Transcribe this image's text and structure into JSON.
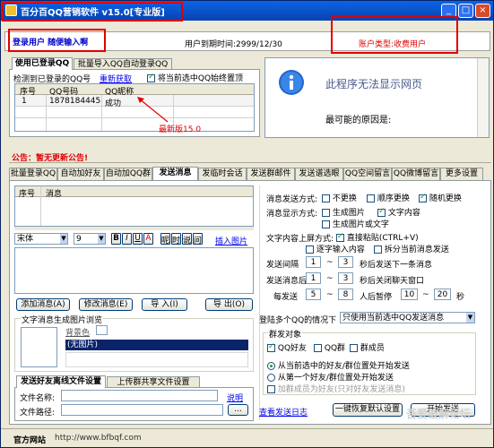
{
  "window": {
    "title": "百分百QQ营销软件 v15.0[专业版]",
    "min": "_",
    "max": "□",
    "close": "×"
  },
  "info": {
    "user_hint": "登录用户 随便输入啊",
    "expire_label": "用户到期时间:2999/12/30",
    "account_type": "账户类型:收费用户"
  },
  "qq_tabs": [
    "使用已登录QQ",
    "批量导入QQ自动登录QQ"
  ],
  "qq_section": {
    "detect_label": "检测到已登录的QQ号",
    "refresh_link": "重新获取",
    "pin_label": "将当前选中QQ始终置顶",
    "columns": [
      "序号",
      "QQ号码",
      "QQ昵称"
    ],
    "rows": [
      {
        "idx": "1",
        "qq": "1878184445",
        "nick": "成功"
      }
    ],
    "version_note": "最新版15.0"
  },
  "web_panel": {
    "message": "此程序无法显示网页",
    "reason": "最可能的原因是:"
  },
  "notice": "公告：暂无更新公告!",
  "main_tabs": [
    "批量登录QQ",
    "自动加好友",
    "自动加QQ群",
    "发送消息",
    "发临时会话",
    "发送群邮件",
    "发送谱选眼",
    "QQ空间留言",
    "QQ微博留言",
    "更多设置"
  ],
  "messages": {
    "columns": [
      "序号",
      "消息"
    ],
    "font_name": "宋体",
    "font_size": "9",
    "style_buttons": [
      "B",
      "I",
      "U",
      "A"
    ],
    "effect_buttons": [
      "呢",
      "时",
      "说",
      "问"
    ],
    "insert_image": "插入图片",
    "buttons": [
      "添加消息(A)",
      "修改消息(E)",
      "导  入(I)",
      "导  出(O)"
    ]
  },
  "preview": {
    "title": "文字消息生成图片浏览",
    "bg_label": "背景色",
    "no_image": "(无图片)"
  },
  "file_tabs": [
    "发送好友离线文件设置",
    "上传群共享文件设置"
  ],
  "file_fields": {
    "name_label": "文件名称:",
    "path_label": "文件路径:",
    "help_link": "说明",
    "browse": "..."
  },
  "send_settings": {
    "mode_label": "消息发送方式:",
    "mode_options": [
      {
        "label": "不更换",
        "on": false
      },
      {
        "label": "顺序更换",
        "on": false
      },
      {
        "label": "随机更换",
        "on": true
      }
    ],
    "display_label": "消息显示方式:",
    "display_options": [
      {
        "label": "生成图片",
        "on": false
      },
      {
        "label": "文字内容",
        "on": true
      },
      {
        "label": "生成图片或文字",
        "on": false
      }
    ],
    "screen_label": "文字内容上屏方式:",
    "screen_options": [
      {
        "label": "直接粘贴(CTRL+V)",
        "on": true
      },
      {
        "label": "逐字输入内容",
        "on": false
      },
      {
        "label": "拆分当前消息发送",
        "on": false
      }
    ],
    "interval_label": "发送间隔",
    "interval_from": "1",
    "interval_to": "3",
    "interval_unit": "秒后发送下一条消息",
    "after_label": "发送消息后",
    "after_from": "1",
    "after_to": "3",
    "after_unit": "秒后关闭聊天窗口",
    "every_label": "每发送",
    "every_from": "5",
    "every_to": "8",
    "pause_label": "人后暂停",
    "pause_from": "10",
    "pause_to": "20",
    "pause_unit": "秒",
    "multi_label": "登陆多个QQ的情况下",
    "multi_value": "只使用当前选中QQ发送消息",
    "target_title": "群发对象",
    "targets": [
      {
        "label": "QQ好友",
        "on": true
      },
      {
        "label": "QQ群",
        "on": false
      },
      {
        "label": "群成员",
        "on": false
      }
    ],
    "start_options": [
      {
        "label": "从当前选中的好友/群位置处开始发送",
        "on": true
      },
      {
        "label": "从第一个好友/群位置处开始发送",
        "on": false
      }
    ],
    "blank_option": "加群成员为好友(只对好友发送消息)",
    "log_link": "查看发送日志",
    "restore_btn": "一键恢复默认设置",
    "start_btn": "开始发送"
  },
  "status": {
    "site": "官方网站",
    "url": "http://www.bfbqf.com"
  },
  "watermark": "吾爱破解论坛"
}
